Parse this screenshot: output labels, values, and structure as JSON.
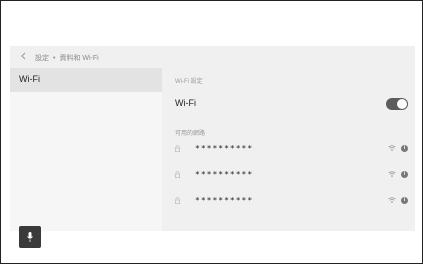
{
  "header": {
    "back_icon": "chevron-left-icon",
    "breadcrumb": [
      "設定",
      "資料和 Wi-Fi"
    ],
    "separator": "•"
  },
  "sidebar": {
    "items": [
      {
        "label": "Wi-Fi",
        "selected": true
      }
    ],
    "voice_button_icon": "microphone-icon"
  },
  "main": {
    "settings_section_label": "Wi-Fi 設定",
    "wifi_toggle": {
      "label": "Wi-Fi",
      "state": "on"
    },
    "available_section_label": "可用的網路",
    "networks": [
      {
        "ssid": "**********",
        "locked": true,
        "signal_icon": "wifi-signal-icon",
        "info_icon": "info-icon"
      },
      {
        "ssid": "**********",
        "locked": true,
        "signal_icon": "wifi-signal-icon",
        "info_icon": "info-icon"
      },
      {
        "ssid": "**********",
        "locked": true,
        "signal_icon": "wifi-signal-icon",
        "info_icon": "info-icon"
      }
    ]
  },
  "colors": {
    "screen_bg": "#f0f0f0",
    "selected_item_bg": "#e3e3e3",
    "toggle_on": "#5c5c5c",
    "mic_button": "#3a3a3a"
  }
}
